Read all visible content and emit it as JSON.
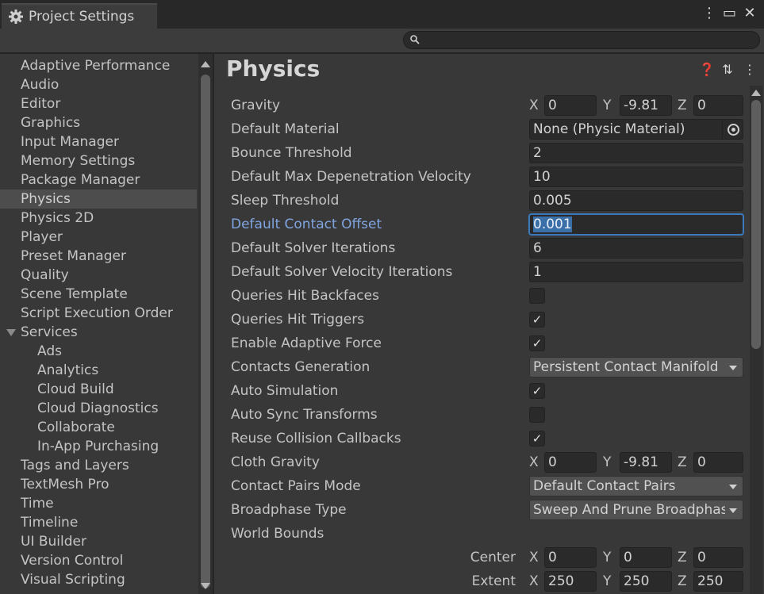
{
  "window": {
    "tab_title": "Project Settings",
    "controls": [
      "more-options-icon",
      "maximize-icon",
      "close-icon"
    ]
  },
  "search": {
    "placeholder": ""
  },
  "sidebar": {
    "items": [
      {
        "label": "Adaptive Performance",
        "indent": 0
      },
      {
        "label": "Audio",
        "indent": 0
      },
      {
        "label": "Editor",
        "indent": 0
      },
      {
        "label": "Graphics",
        "indent": 0
      },
      {
        "label": "Input Manager",
        "indent": 0
      },
      {
        "label": "Memory Settings",
        "indent": 0
      },
      {
        "label": "Package Manager",
        "indent": 0
      },
      {
        "label": "Physics",
        "indent": 0,
        "selected": true
      },
      {
        "label": "Physics 2D",
        "indent": 0
      },
      {
        "label": "Player",
        "indent": 0
      },
      {
        "label": "Preset Manager",
        "indent": 0
      },
      {
        "label": "Quality",
        "indent": 0
      },
      {
        "label": "Scene Template",
        "indent": 0
      },
      {
        "label": "Script Execution Order",
        "indent": 0
      },
      {
        "label": "Services",
        "indent": 0,
        "expanded": true
      },
      {
        "label": "Ads",
        "indent": 1
      },
      {
        "label": "Analytics",
        "indent": 1
      },
      {
        "label": "Cloud Build",
        "indent": 1
      },
      {
        "label": "Cloud Diagnostics",
        "indent": 1
      },
      {
        "label": "Collaborate",
        "indent": 1
      },
      {
        "label": "In-App Purchasing",
        "indent": 1
      },
      {
        "label": "Tags and Layers",
        "indent": 0
      },
      {
        "label": "TextMesh Pro",
        "indent": 0
      },
      {
        "label": "Time",
        "indent": 0
      },
      {
        "label": "Timeline",
        "indent": 0
      },
      {
        "label": "UI Builder",
        "indent": 0
      },
      {
        "label": "Version Control",
        "indent": 0
      },
      {
        "label": "Visual Scripting",
        "indent": 0
      }
    ]
  },
  "main": {
    "title": "Physics",
    "header_icons": [
      "help-icon",
      "preset-icon",
      "more-icon"
    ],
    "axis": {
      "x": "X",
      "y": "Y",
      "z": "Z"
    },
    "gravity": {
      "label": "Gravity",
      "x": "0",
      "y": "-9.81",
      "z": "0"
    },
    "default_material": {
      "label": "Default Material",
      "value": "None (Physic Material)"
    },
    "bounce_threshold": {
      "label": "Bounce Threshold",
      "value": "2"
    },
    "max_depen": {
      "label": "Default Max Depenetration Velocity",
      "value": "10"
    },
    "sleep_threshold": {
      "label": "Sleep Threshold",
      "value": "0.005"
    },
    "contact_offset": {
      "label": "Default Contact Offset",
      "value": "0.001"
    },
    "solver_iter": {
      "label": "Default Solver Iterations",
      "value": "6"
    },
    "solver_vel_iter": {
      "label": "Default Solver Velocity Iterations",
      "value": "1"
    },
    "queries_backfaces": {
      "label": "Queries Hit Backfaces",
      "checked": false
    },
    "queries_triggers": {
      "label": "Queries Hit Triggers",
      "checked": true,
      "mark": "✓"
    },
    "adaptive_force": {
      "label": "Enable Adaptive Force",
      "checked": true,
      "mark": "✓"
    },
    "contacts_generation": {
      "label": "Contacts Generation",
      "value": "Persistent Contact Manifold"
    },
    "auto_simulation": {
      "label": "Auto Simulation",
      "checked": true,
      "mark": "✓"
    },
    "auto_sync": {
      "label": "Auto Sync Transforms",
      "checked": false
    },
    "reuse_callbacks": {
      "label": "Reuse Collision Callbacks",
      "checked": true,
      "mark": "✓"
    },
    "cloth_gravity": {
      "label": "Cloth Gravity",
      "x": "0",
      "y": "-9.81",
      "z": "0"
    },
    "contact_pairs": {
      "label": "Contact Pairs Mode",
      "value": "Default Contact Pairs"
    },
    "broadphase": {
      "label": "Broadphase Type",
      "value": "Sweep And Prune Broadphase"
    },
    "world_bounds": {
      "label": "World Bounds",
      "center": {
        "label": "Center",
        "x": "0",
        "y": "0",
        "z": "0"
      },
      "extent": {
        "label": "Extent",
        "x": "250",
        "y": "250",
        "z": "250"
      }
    }
  }
}
